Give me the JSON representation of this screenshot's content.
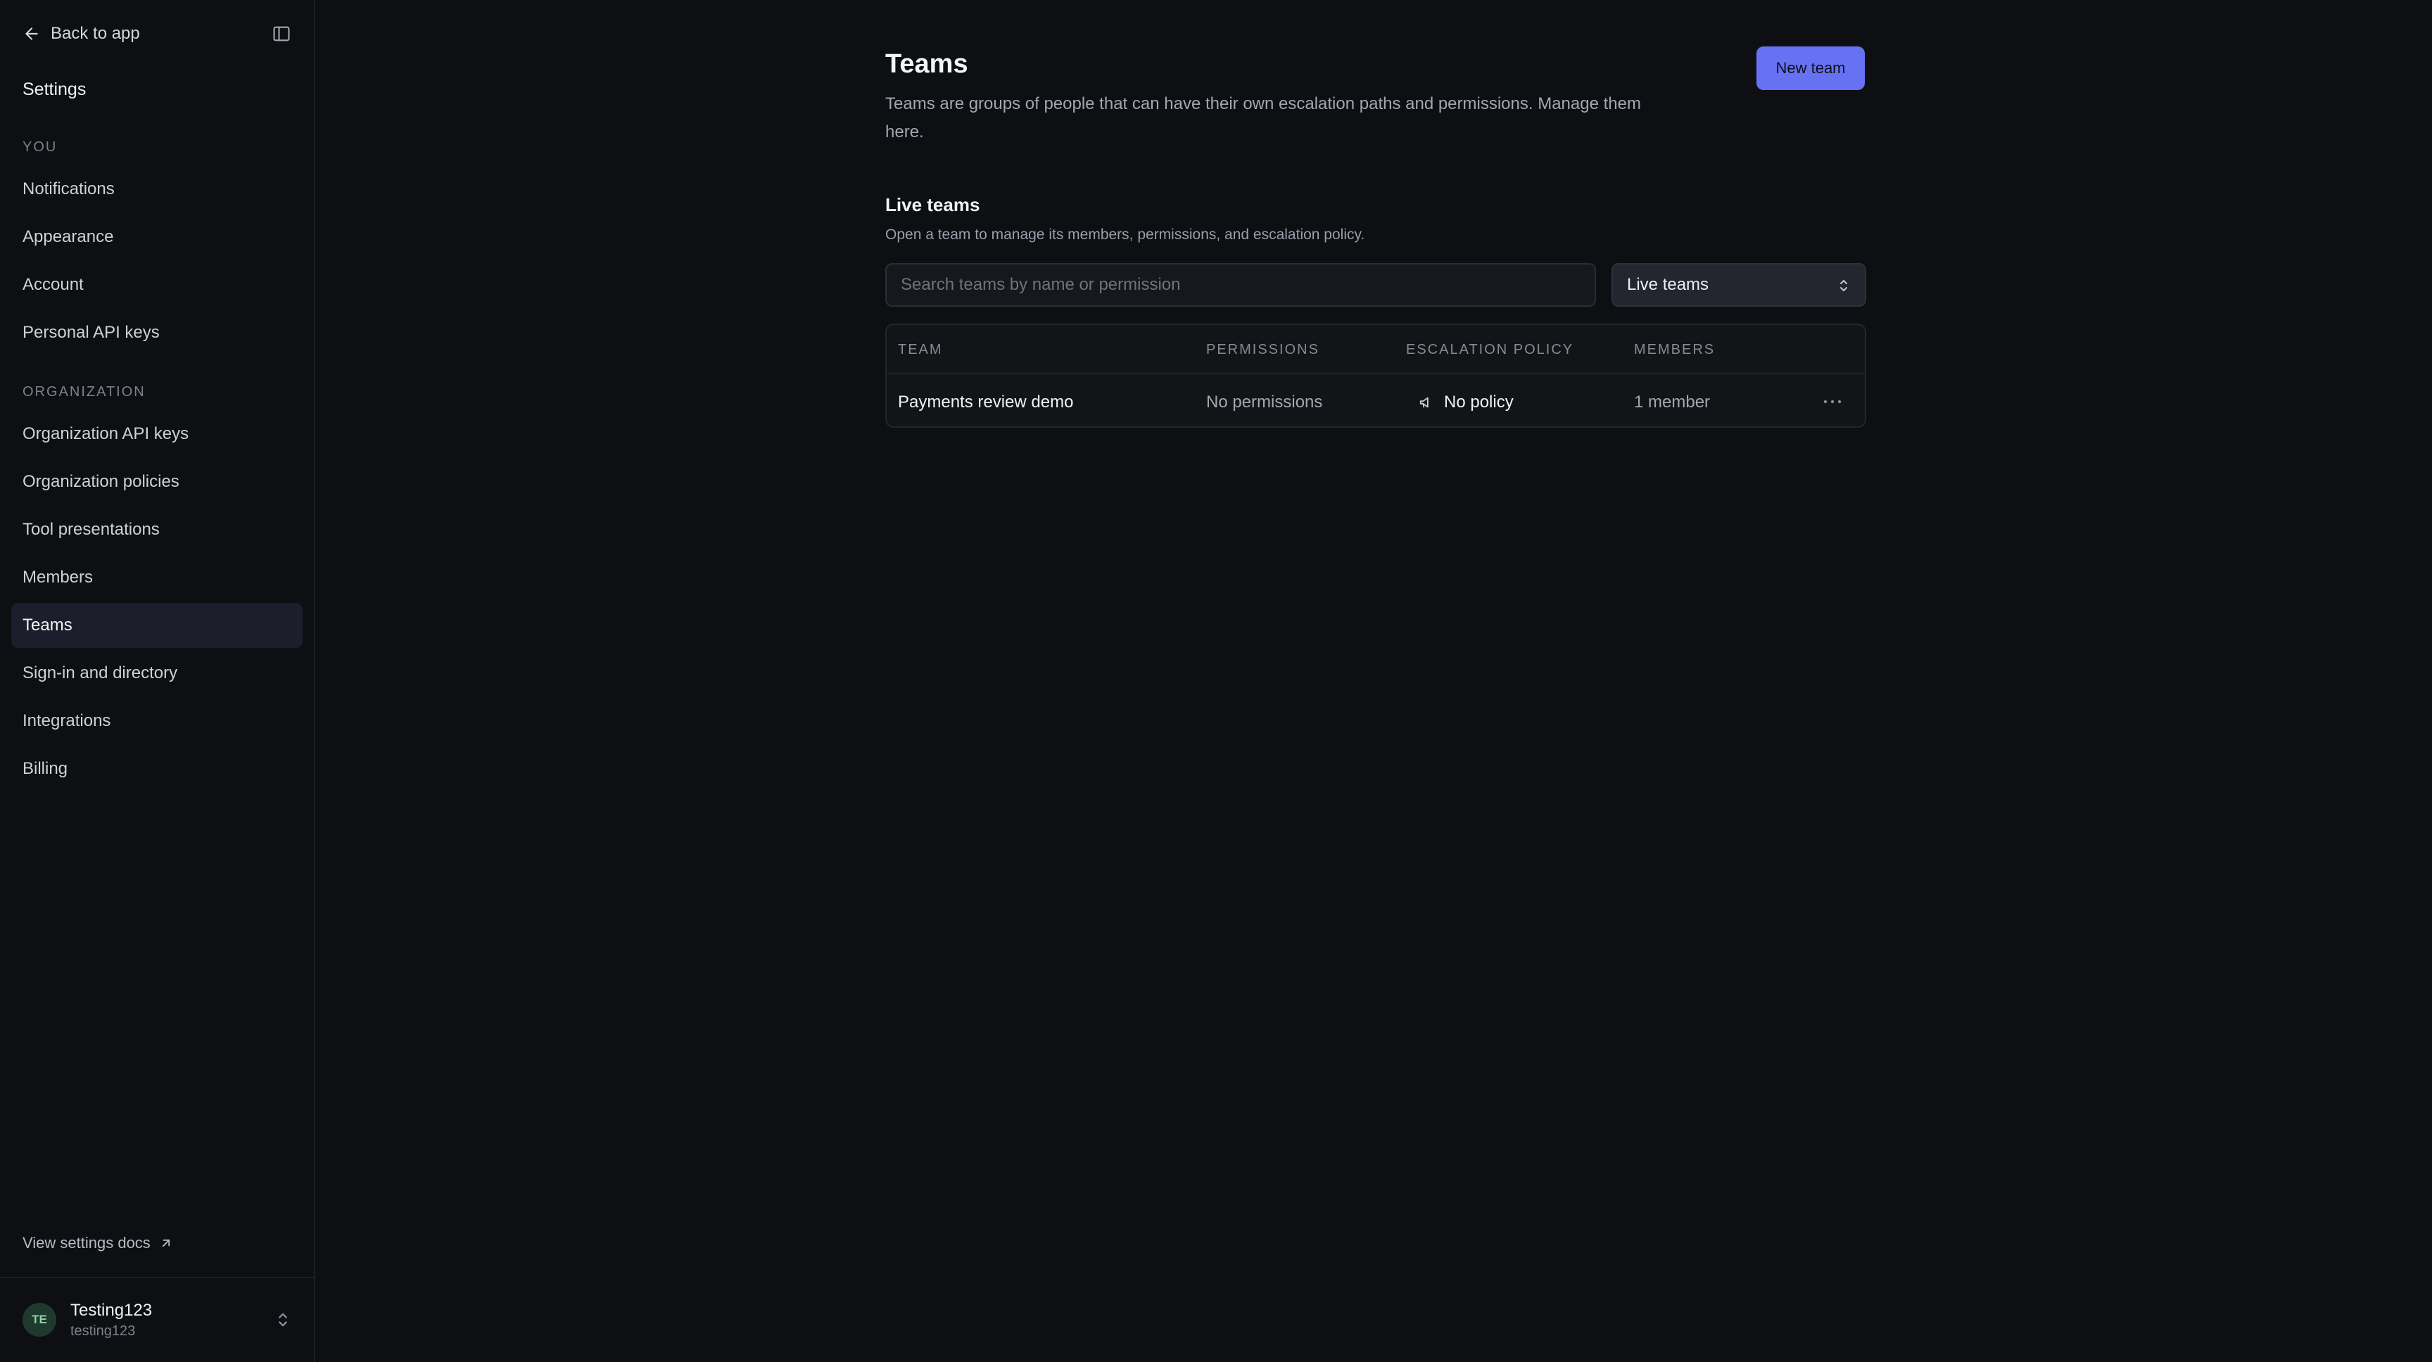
{
  "sidebar": {
    "back_label": "Back to app",
    "title": "Settings",
    "sections": [
      {
        "label": "YOU",
        "items": [
          "Notifications",
          "Appearance",
          "Account",
          "Personal API keys"
        ]
      },
      {
        "label": "ORGANIZATION",
        "items": [
          "Organization API keys",
          "Organization policies",
          "Tool presentations",
          "Members",
          "Teams",
          "Sign-in and directory",
          "Integrations",
          "Billing"
        ]
      }
    ],
    "active_item": "Teams",
    "docs_label": "View settings docs",
    "user": {
      "initials": "TE",
      "name": "Testing123",
      "handle": "testing123"
    }
  },
  "main": {
    "title": "Teams",
    "description": "Teams are groups of people that can have their own escalation paths and permissions. Manage them here.",
    "new_team_label": "New team",
    "live_section": {
      "title": "Live teams",
      "description": "Open a team to manage its members, permissions, and escalation policy."
    },
    "search": {
      "placeholder": "Search teams by name or permission",
      "value": ""
    },
    "filter": {
      "selected": "Live teams"
    },
    "table": {
      "columns": [
        "TEAM",
        "PERMISSIONS",
        "ESCALATION POLICY",
        "MEMBERS"
      ],
      "rows": [
        {
          "team": "Payments review demo",
          "permissions": "No permissions",
          "policy": "No policy",
          "members": "1 member"
        }
      ]
    }
  },
  "colors": {
    "background": "#0e0f13",
    "accent": "#6672f2",
    "active_nav": "#1c1f2b",
    "avatar_bg": "#1f3a2c"
  },
  "icons": [
    "arrow-left-icon",
    "sidebar-toggle-icon",
    "external-link-icon",
    "chevron-up-down-icon",
    "megaphone-icon",
    "more-horizontal-icon"
  ]
}
